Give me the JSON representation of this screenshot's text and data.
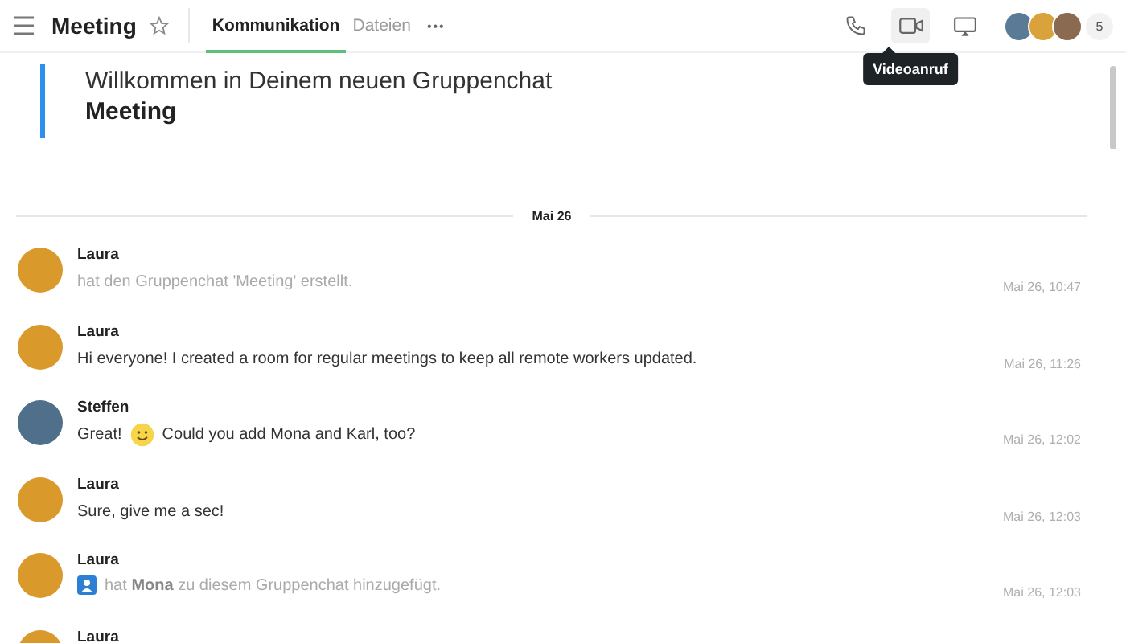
{
  "header": {
    "title": "Meeting",
    "favorite": false,
    "tabs": [
      {
        "label": "Kommunikation",
        "selected": true
      },
      {
        "label": "Dateien",
        "selected": false
      }
    ],
    "more": "•••",
    "actions": [
      {
        "kind": "phone",
        "active": false
      },
      {
        "kind": "video",
        "active": true,
        "tooltip": "Videoanruf"
      },
      {
        "kind": "screen",
        "active": false
      }
    ],
    "participants": [
      {
        "color": "#5a7a95"
      },
      {
        "color": "#d9a23a"
      },
      {
        "color": "#8a6a50"
      }
    ],
    "participant_count": "5"
  },
  "welcome": {
    "line": "Willkommen in Deinem neuen Gruppenchat",
    "name": "Meeting"
  },
  "date_divider": "Mai 26",
  "messages": [
    {
      "author": "Laura",
      "color": "#d99a2b",
      "kind": "system",
      "text": "hat den Gruppenchat 'Meeting' erstellt.",
      "time": "Mai 26, 10:47"
    },
    {
      "author": "Laura",
      "color": "#d99a2b",
      "kind": "text",
      "text": "Hi everyone! I created a room for regular meetings to keep all remote workers updated.",
      "time": "Mai 26, 11:26"
    },
    {
      "author": "Steffen",
      "color": "#4f6f8a",
      "kind": "emoji",
      "text": "Great!",
      "text_after": "Could you add Mona and Karl, too?",
      "time": "Mai 26, 12:02"
    },
    {
      "author": "Laura",
      "color": "#d99a2b",
      "kind": "text",
      "text": "Sure, give me a sec!",
      "time": "Mai 26, 12:03"
    },
    {
      "author": "Laura",
      "color": "#d99a2b",
      "kind": "member",
      "text": "hat **Mona** zu diesem Gruppenchat hinzugefügt.",
      "time": "Mai 26, 12:03"
    },
    {
      "author": "Laura",
      "color": "#d99a2b",
      "kind": "partial"
    }
  ]
}
